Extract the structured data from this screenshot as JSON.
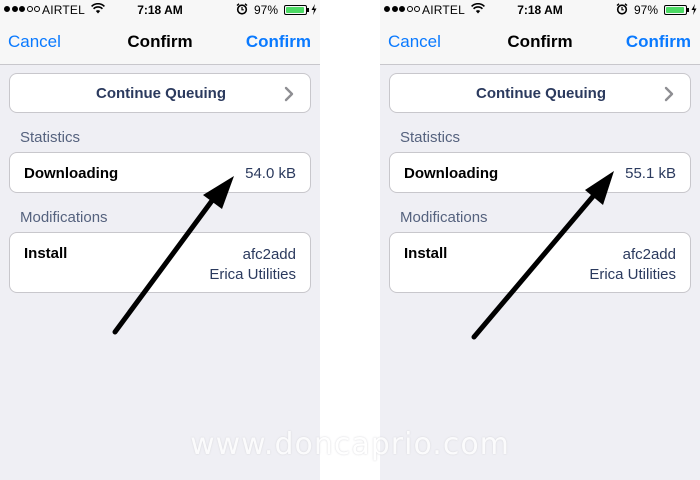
{
  "status_bar": {
    "carrier": "AIRTEL",
    "time": "7:18 AM",
    "battery_percent": "97%",
    "battery_level": 0.97,
    "signal_bars_filled": 3,
    "signal_bars_total": 5
  },
  "nav": {
    "cancel_label": "Cancel",
    "title": "Confirm",
    "confirm_label": "Confirm"
  },
  "queue": {
    "label": "Continue Queuing"
  },
  "statistics": {
    "header": "Statistics",
    "downloading_label": "Downloading"
  },
  "modifications": {
    "header": "Modifications",
    "install_label": "Install",
    "package_name": "afc2add",
    "package_author": "Erica Utilities"
  },
  "screens": [
    {
      "downloading_value": "54.0 kB"
    },
    {
      "downloading_value": "55.1 kB"
    }
  ],
  "watermark": "www.doncaprio.com",
  "colors": {
    "accent": "#0a7aff",
    "background": "#efeff4",
    "battery": "#4cd964",
    "value_text": "#2b3a5e"
  },
  "icons": [
    "wifi-icon",
    "alarm-icon",
    "battery-icon",
    "charging-bolt-icon",
    "chevron-right-icon",
    "annotation-arrow"
  ]
}
